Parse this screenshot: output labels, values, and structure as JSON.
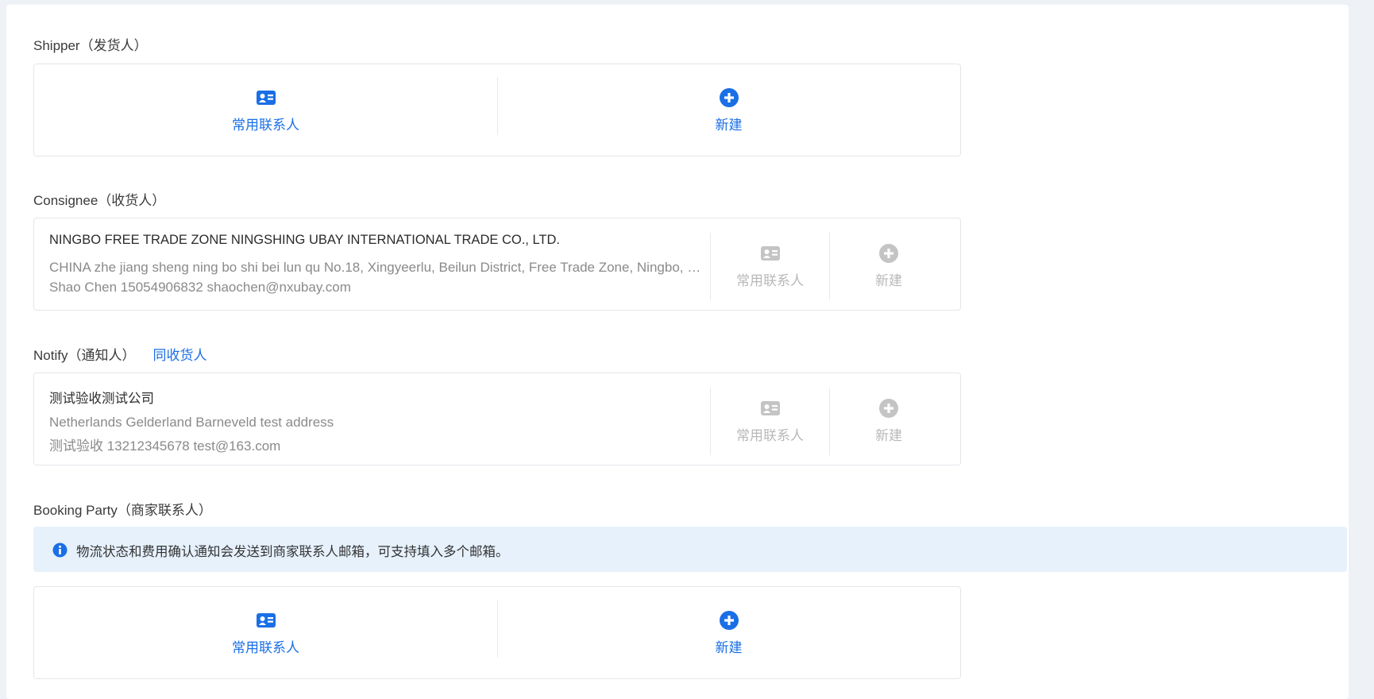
{
  "shipper": {
    "label": "Shipper（发货人）",
    "frequent_contacts_label": "常用联系人",
    "new_label": "新建"
  },
  "consignee": {
    "label": "Consignee（收货人）",
    "company": "NINGBO FREE TRADE ZONE NINGSHING UBAY INTERNATIONAL TRADE CO., LTD.",
    "address": "CHINA zhe jiang sheng ning bo shi bei lun qu No.18, Xingyeerlu, Beilun District, Free Trade Zone, Ningbo, Zhejiang, China",
    "contact": "Shao Chen 15054906832 shaochen@nxubay.com",
    "frequent_contacts_label": "常用联系人",
    "new_label": "新建"
  },
  "notify": {
    "label": "Notify（通知人）",
    "same_as_consignee": "同收货人",
    "company": "测试验收测试公司",
    "address": "Netherlands Gelderland Barneveld test address",
    "contact": "测试验收 13212345678 test@163.com",
    "frequent_contacts_label": "常用联系人",
    "new_label": "新建"
  },
  "booking_party": {
    "label": "Booking Party（商家联系人）",
    "notice": "物流状态和费用确认通知会发送到商家联系人邮箱，可支持填入多个邮箱。",
    "frequent_contacts_label": "常用联系人",
    "new_label": "新建"
  },
  "icons": {
    "contact_card": "contact-card-icon",
    "add": "plus-circle-icon",
    "info": "info-icon"
  },
  "colors": {
    "accent": "#1a6fe6",
    "disabled": "#c4c4c4",
    "notice_bg": "#e6f1fc",
    "page_bg": "#eef2f7"
  }
}
